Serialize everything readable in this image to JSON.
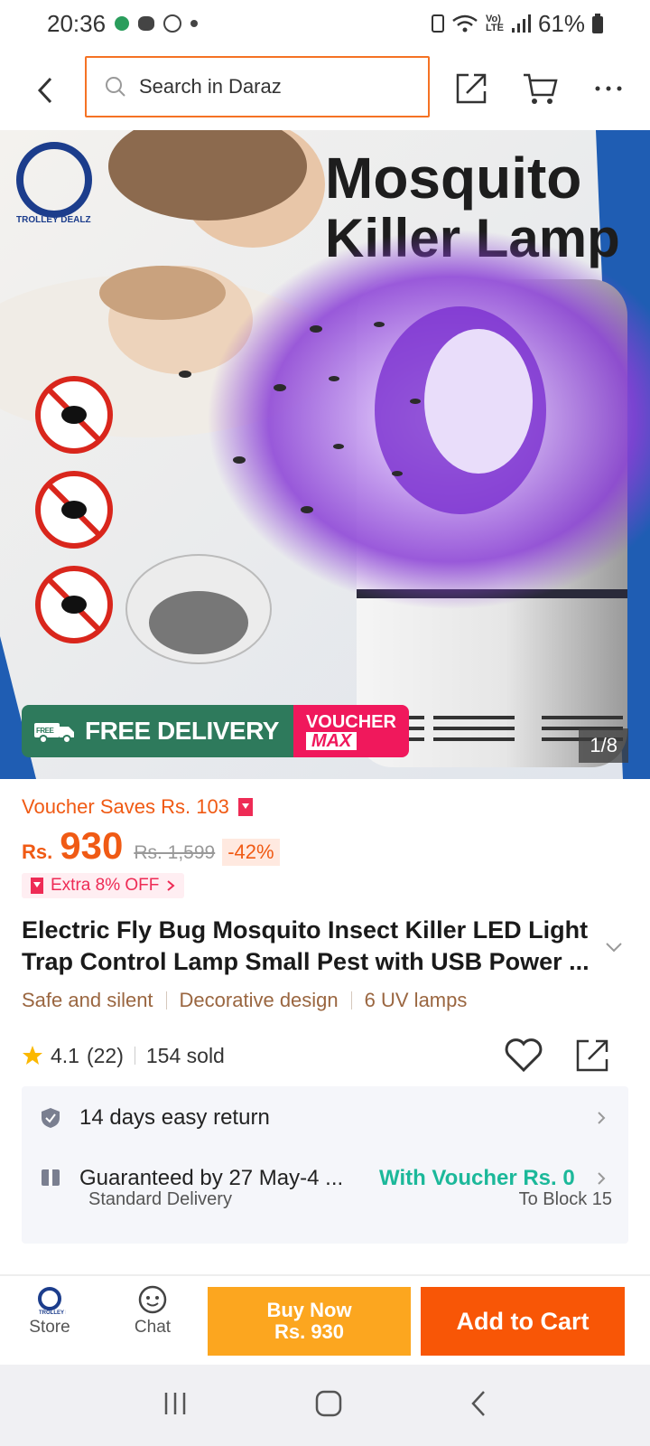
{
  "status_bar": {
    "time": "20:36",
    "battery": "61%"
  },
  "search": {
    "placeholder": "Search in Daraz"
  },
  "product_image": {
    "counter": "1/8",
    "headline_line1": "Mosquito",
    "headline_line2": "Killer Lamp",
    "brand": "TROLLEY DEALZ",
    "promo_free_tag": "FREE",
    "promo_free_label": "FREE DELIVERY",
    "promo_voucher_line1": "VOUCHER",
    "promo_voucher_line2": "MAX"
  },
  "pricing": {
    "voucher_saves": "Voucher Saves Rs. 103",
    "currency": "Rs.",
    "price": "930",
    "original_price": "Rs. 1,599",
    "discount": "-42%",
    "extra_off": "Extra 8% OFF"
  },
  "product": {
    "title": "Electric Fly Bug Mosquito Insect Killer LED Light Trap Control Lamp Small Pest with USB Power ...",
    "features": [
      "Safe and silent",
      "Decorative design",
      "6 UV lamps"
    ],
    "rating": "4.1",
    "reviews": "(22)",
    "sold": "154 sold"
  },
  "services": {
    "return_text": "14 days easy return",
    "delivery_text": "Guaranteed by 27 May-4 ...",
    "voucher_text": "With Voucher Rs. 0",
    "delivery_type": "Standard Delivery",
    "location": "To Block 15"
  },
  "bottom_bar": {
    "store_label": "Store",
    "chat_label": "Chat",
    "buy_now_line1": "Buy Now",
    "buy_now_line2": "Rs. 930",
    "add_to_cart": "Add to Cart"
  },
  "colors": {
    "accent": "#f85606",
    "price": "#f05a14",
    "buy_now": "#fca61f",
    "voucher_green": "#1cb89a"
  }
}
